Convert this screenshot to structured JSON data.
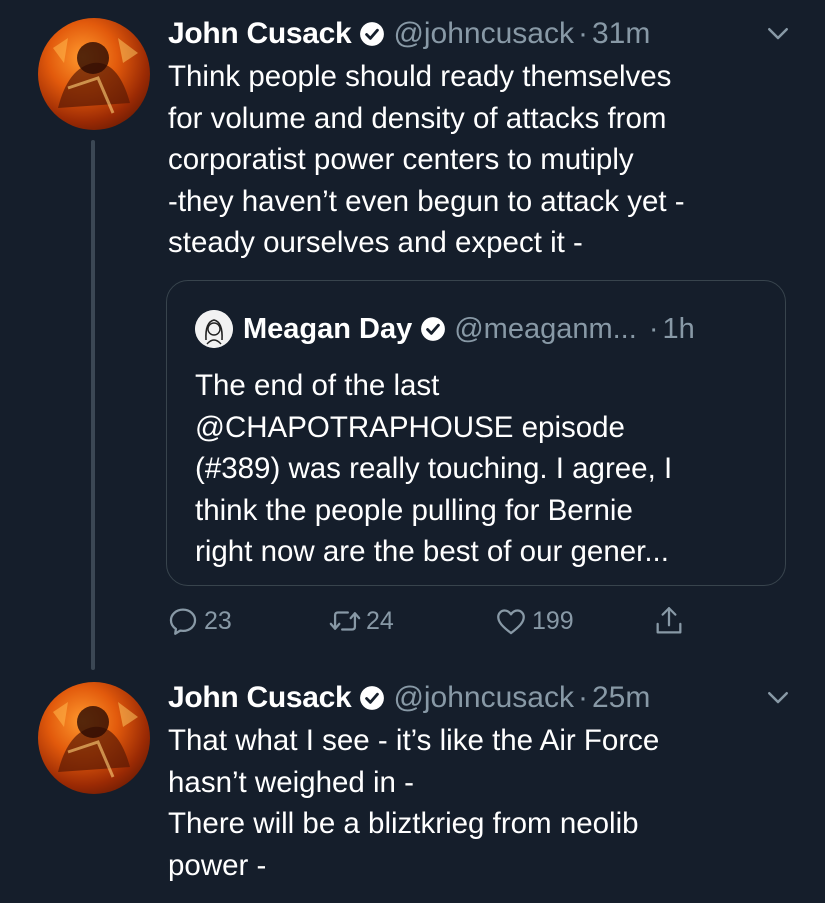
{
  "tweets": [
    {
      "name": "John Cusack",
      "handle": "@johncusack",
      "separator": "·",
      "time": "31m",
      "text": "Think people should ready themselves\nfor volume and density of attacks from\ncorporatist power centers to mutiply\n-they haven’t even begun to attack yet -\nsteady ourselves  and expect it -",
      "quote": {
        "name": "Meagan Day",
        "handle": "@meaganm...",
        "separator": "·",
        "time": "1h",
        "text": "The end of the last\n@CHAPOTRAPHOUSE episode\n(#389) was really touching. I agree, I\nthink the people pulling for Bernie\nright now are the best of our gener..."
      },
      "actions": {
        "replies": "23",
        "retweets": "24",
        "likes": "199"
      }
    },
    {
      "name": "John Cusack",
      "handle": "@johncusack",
      "separator": "·",
      "time": "25m",
      "text": "That what I see -  it’s like the Air Force\nhasn’t weighed in -\nThere will be a bliztkrieg from neolib\npower -"
    }
  ],
  "icons": {
    "verified": "verified-badge-icon",
    "caret": "chevron-down-icon",
    "reply": "reply-icon",
    "retweet": "retweet-icon",
    "like": "heart-icon",
    "share": "share-icon"
  },
  "colors": {
    "background": "#151e2b",
    "text": "#ffffff",
    "muted": "#8899a6",
    "border": "#38444d"
  }
}
